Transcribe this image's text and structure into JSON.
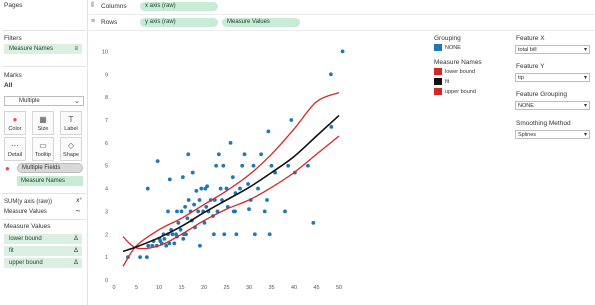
{
  "left": {
    "pages_title": "Pages",
    "filters_title": "Filters",
    "filter_pill": "Measure Names",
    "marks_title": "Marks",
    "marks_all": "All",
    "mark_type": "Multiple",
    "mark_buttons": [
      "Color",
      "Size",
      "Label",
      "Detail",
      "Tooltip",
      "Shape"
    ],
    "multiple_fields": "Multiple Fields",
    "measure_names_pill": "Measure Names",
    "sum_label": "SUM(y axis (raw))",
    "measure_values_label": "Measure Values",
    "measure_values_title": "Measure Values",
    "measure_rows": [
      "lower bound",
      "fit",
      "upper bound"
    ],
    "delta_symbol": "Δ"
  },
  "shelves": {
    "columns_label": "Columns",
    "columns_pill": "x axis (raw)",
    "rows_label": "Rows",
    "rows_pills": [
      "y axis (raw)",
      "Measure Values"
    ]
  },
  "legend": {
    "grouping_title": "Grouping",
    "grouping_item": "NONE",
    "grouping_color": "#1f77b4",
    "measure_names_title": "Measure Names",
    "items": [
      {
        "label": "lower bound",
        "color": "#d62728"
      },
      {
        "label": "fit",
        "color": "#111111"
      },
      {
        "label": "upper bound",
        "color": "#d62728"
      }
    ]
  },
  "controls": [
    {
      "label": "Feature X",
      "value": "total bill"
    },
    {
      "label": "Feature Y",
      "value": "tip"
    },
    {
      "label": "Feature Grouping",
      "value": "NONE"
    },
    {
      "label": "Smoothing Method",
      "value": "Splines"
    }
  ],
  "chart_data": {
    "type": "scatter",
    "xlim": [
      0,
      52
    ],
    "ylim": [
      0,
      10.5
    ],
    "x_ticks": [
      "0",
      "5",
      "10",
      "15",
      "20",
      "25",
      "30",
      "35",
      "40",
      "45",
      "50"
    ],
    "y_ticks": [
      "0",
      "1",
      "2",
      "3",
      "4",
      "5",
      "6",
      "7",
      "8",
      "9",
      "10"
    ],
    "points_color": "#1f77b4",
    "points": [
      [
        3.1,
        1.0
      ],
      [
        5.8,
        1.0
      ],
      [
        7.3,
        1.0
      ],
      [
        7.6,
        1.5
      ],
      [
        8.5,
        1.5
      ],
      [
        8.8,
        1.7
      ],
      [
        9.5,
        1.5
      ],
      [
        10.1,
        1.8
      ],
      [
        10.3,
        1.7
      ],
      [
        10.6,
        1.6
      ],
      [
        11.0,
        2.0
      ],
      [
        11.2,
        1.8
      ],
      [
        11.6,
        1.5
      ],
      [
        12.0,
        2.0
      ],
      [
        12.3,
        1.6
      ],
      [
        12.7,
        2.2
      ],
      [
        13.0,
        2.0
      ],
      [
        13.4,
        1.6
      ],
      [
        13.8,
        2.0
      ],
      [
        14.0,
        3.0
      ],
      [
        14.3,
        2.5
      ],
      [
        14.8,
        2.2
      ],
      [
        15.0,
        3.0
      ],
      [
        15.4,
        1.8
      ],
      [
        15.8,
        3.2
      ],
      [
        16.0,
        2.0
      ],
      [
        16.3,
        2.7
      ],
      [
        16.6,
        3.5
      ],
      [
        17.0,
        3.0
      ],
      [
        17.3,
        2.6
      ],
      [
        17.8,
        3.3
      ],
      [
        18.0,
        2.3
      ],
      [
        18.3,
        3.9
      ],
      [
        18.7,
        3.0
      ],
      [
        19.0,
        3.5
      ],
      [
        19.4,
        4.0
      ],
      [
        19.8,
        3.0
      ],
      [
        20.1,
        2.5
      ],
      [
        20.5,
        3.2
      ],
      [
        20.7,
        4.1
      ],
      [
        21.0,
        3.0
      ],
      [
        21.5,
        3.5
      ],
      [
        22.0,
        2.8
      ],
      [
        22.4,
        3.5
      ],
      [
        22.7,
        5.0
      ],
      [
        23.0,
        3.0
      ],
      [
        23.3,
        5.5
      ],
      [
        23.7,
        4.0
      ],
      [
        24.0,
        3.5
      ],
      [
        24.5,
        2.0
      ],
      [
        25.0,
        4.0
      ],
      [
        25.3,
        3.2
      ],
      [
        25.9,
        6.0
      ],
      [
        26.4,
        4.5
      ],
      [
        26.9,
        3.0
      ],
      [
        27.2,
        2.0
      ],
      [
        28.0,
        4.0
      ],
      [
        28.5,
        5.0
      ],
      [
        29.0,
        5.5
      ],
      [
        29.8,
        4.2
      ],
      [
        30.4,
        3.5
      ],
      [
        31.0,
        5.0
      ],
      [
        31.3,
        2.0
      ],
      [
        32.0,
        4.0
      ],
      [
        32.7,
        5.5
      ],
      [
        33.5,
        3.0
      ],
      [
        34.0,
        3.5
      ],
      [
        34.3,
        6.5
      ],
      [
        35.0,
        5.0
      ],
      [
        35.8,
        4.7
      ],
      [
        38.0,
        3.0
      ],
      [
        38.7,
        5.0
      ],
      [
        39.4,
        7.0
      ],
      [
        40.2,
        4.7
      ],
      [
        43.1,
        5.0
      ],
      [
        44.3,
        2.5
      ],
      [
        48.2,
        9.0
      ],
      [
        48.3,
        6.7
      ],
      [
        50.8,
        10.0
      ],
      [
        34.6,
        2.0
      ],
      [
        9.7,
        5.2
      ],
      [
        16.5,
        5.5
      ],
      [
        15.3,
        4.5
      ],
      [
        12.4,
        4.4
      ],
      [
        20.3,
        4.0
      ],
      [
        24.3,
        5.0
      ],
      [
        22.2,
        2.0
      ],
      [
        26.6,
        3.0
      ],
      [
        7.5,
        4.0
      ],
      [
        17.5,
        4.7
      ],
      [
        15.5,
        2.0
      ],
      [
        12.0,
        3.0
      ],
      [
        14.0,
        1.9
      ],
      [
        19.1,
        1.5
      ],
      [
        27.0,
        3.8
      ],
      [
        30.0,
        3.1
      ]
    ],
    "fit_x": [
      2,
      5,
      10,
      15,
      20,
      25,
      30,
      35,
      40,
      45,
      50
    ],
    "fit": [
      1.25,
      1.45,
      1.85,
      2.35,
      2.95,
      3.5,
      4.05,
      4.7,
      5.4,
      6.3,
      7.2
    ],
    "lower_bound": [
      1.9,
      1.4,
      1.5,
      2.0,
      2.6,
      3.1,
      3.5,
      4.05,
      4.7,
      5.5,
      6.3
    ],
    "upper_bound": [
      0.6,
      1.5,
      2.2,
      2.7,
      3.3,
      3.9,
      4.6,
      5.5,
      6.6,
      7.8,
      8.2
    ],
    "fit_color": "#111111",
    "bound_color": "#d62728"
  }
}
